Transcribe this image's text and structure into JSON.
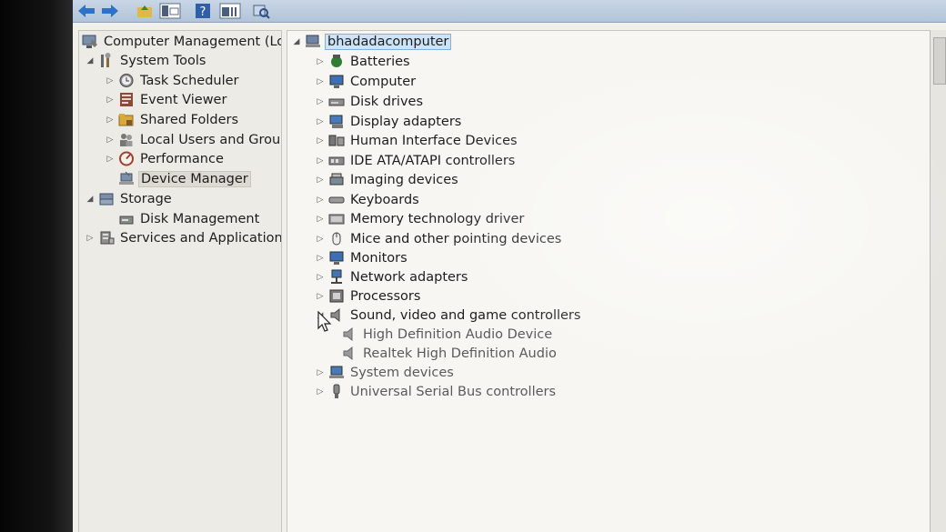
{
  "toolbar": {
    "buttons": [
      {
        "name": "back-button",
        "icon": "arrow-left-icon"
      },
      {
        "name": "forward-button",
        "icon": "arrow-right-icon"
      },
      {
        "name": "up-folder-button",
        "icon": "folder-up-icon"
      },
      {
        "name": "show-hide-tree-button",
        "icon": "console-tree-icon"
      },
      {
        "name": "help-button",
        "icon": "help-icon"
      },
      {
        "name": "properties-button",
        "icon": "properties-icon"
      },
      {
        "name": "scan-hardware-button",
        "icon": "scan-hardware-icon"
      }
    ]
  },
  "left_tree": {
    "root": "Computer Management (Local",
    "system_tools": "System Tools",
    "task_scheduler": "Task Scheduler",
    "event_viewer": "Event Viewer",
    "shared_folders": "Shared Folders",
    "local_users": "Local Users and Groups",
    "performance": "Performance",
    "device_manager": "Device Manager",
    "storage": "Storage",
    "disk_management": "Disk Management",
    "services": "Services and Applications"
  },
  "device_tree": {
    "computer_name": "bhadadacomputer",
    "categories": [
      "Batteries",
      "Computer",
      "Disk drives",
      "Display adapters",
      "Human Interface Devices",
      "IDE ATA/ATAPI controllers",
      "Imaging devices",
      "Keyboards",
      "Memory technology driver",
      "Mice and other pointing devices",
      "Monitors",
      "Network adapters",
      "Processors",
      "Sound, video and game controllers",
      "System devices",
      "Universal Serial Bus controllers"
    ],
    "sound_children": [
      "High Definition Audio Device",
      "Realtek High Definition Audio"
    ]
  }
}
